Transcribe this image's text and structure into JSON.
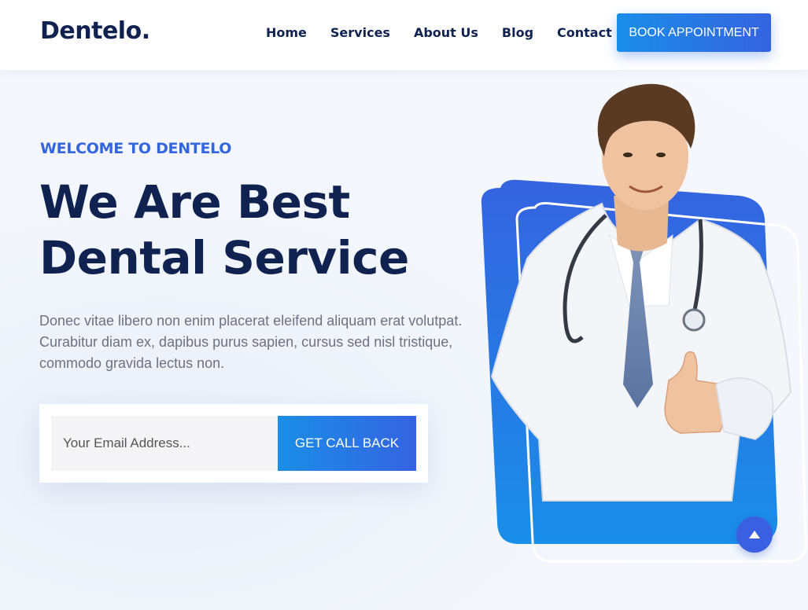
{
  "brand": {
    "logo": "Dentelo."
  },
  "nav": {
    "items": [
      "Home",
      "Services",
      "About Us",
      "Blog",
      "Contact"
    ]
  },
  "header": {
    "cta_label": "BOOK APPOINTMENT"
  },
  "hero": {
    "kicker": "WELCOME TO DENTELO",
    "title_line1": "We Are Best",
    "title_line2": "Dental Service",
    "description": "Donec vitae libero non enim placerat eleifend aliquam erat volutpat. Curabitur diam ex, dapibus purus sapien, cursus sed nisl tristique, commodo gravida lectus non.",
    "email_placeholder": "Your Email Address...",
    "submit_label": "GET CALL BACK"
  },
  "colors": {
    "primary_dark": "#0f2250",
    "accent_blue": "#3366dd",
    "gradient_start": "#1a8ee8",
    "gradient_end": "#3563e0"
  },
  "icons": {
    "scroll_top": "arrow-up-icon"
  }
}
